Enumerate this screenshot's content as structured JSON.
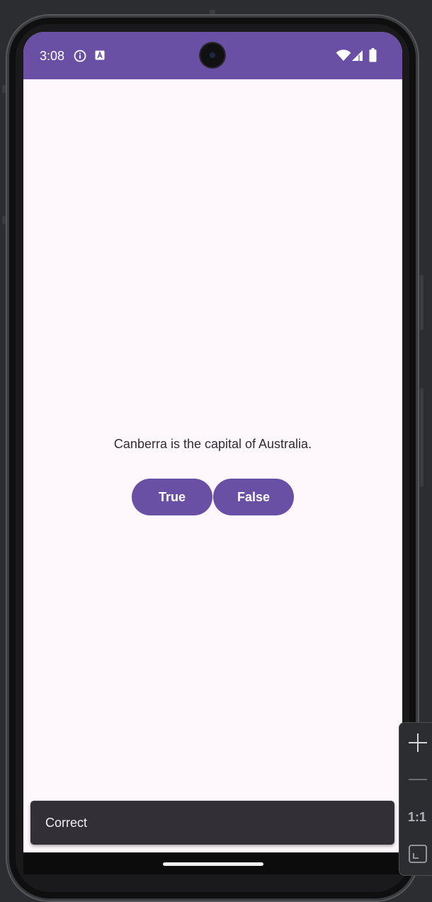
{
  "status_bar": {
    "time": "3:08",
    "background_color": "#6a50a4",
    "icons": [
      "info-icon",
      "a-icon",
      "wifi-icon",
      "signal-icon",
      "battery-icon"
    ]
  },
  "quiz": {
    "question": "Canberra is the capital of Australia.",
    "true_label": "True",
    "false_label": "False",
    "button_color": "#6a50a4"
  },
  "snackbar": {
    "message": "Correct"
  },
  "zoom_controls": {
    "actual_size_label": "1:1",
    "icons": [
      "zoom-in-icon",
      "zoom-out-icon",
      "fit-screen-icon"
    ]
  },
  "colors": {
    "screen_background": "#fef7fc",
    "ide_background": "#2b2d30",
    "snackbar_background": "#323036"
  }
}
